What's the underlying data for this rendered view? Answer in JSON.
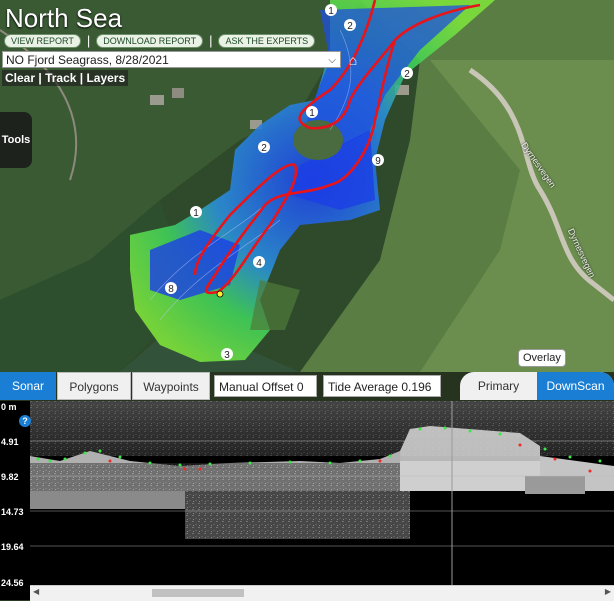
{
  "header": {
    "title": "North Sea",
    "links": [
      "VIEW REPORT",
      "DOWNLOAD REPORT",
      "ASK THE EXPERTS"
    ],
    "survey_select": "NO Fjord Seagrass, 8/28/2021",
    "controls": [
      "Clear",
      "Track",
      "Layers"
    ]
  },
  "map": {
    "tools_label": "Tools",
    "overlay_label": "Overlay",
    "road_labels": [
      "Dyrnesvegen",
      "Dyrnesvegen"
    ],
    "contour_labels": [
      "1",
      "2",
      "2",
      "1",
      "2",
      "9",
      "1",
      "8",
      "4",
      "3"
    ]
  },
  "tabs": {
    "sonar": "Sonar",
    "polygons": "Polygons",
    "waypoints": "Waypoints",
    "manual_offset": "Manual Offset 0 m",
    "tide_average": "Tide Average 0.196 m",
    "primary": "Primary",
    "downscan": "DownScan"
  },
  "sonar": {
    "depth_labels": [
      "0 m",
      "4.91",
      "9.82",
      "14.73",
      "19.64",
      "24.56"
    ],
    "help": "?"
  },
  "colors": {
    "accent": "#1a7fd4",
    "track": "#e8141a",
    "deep": "#1b3fe6",
    "shallow": "#6bd33a"
  }
}
